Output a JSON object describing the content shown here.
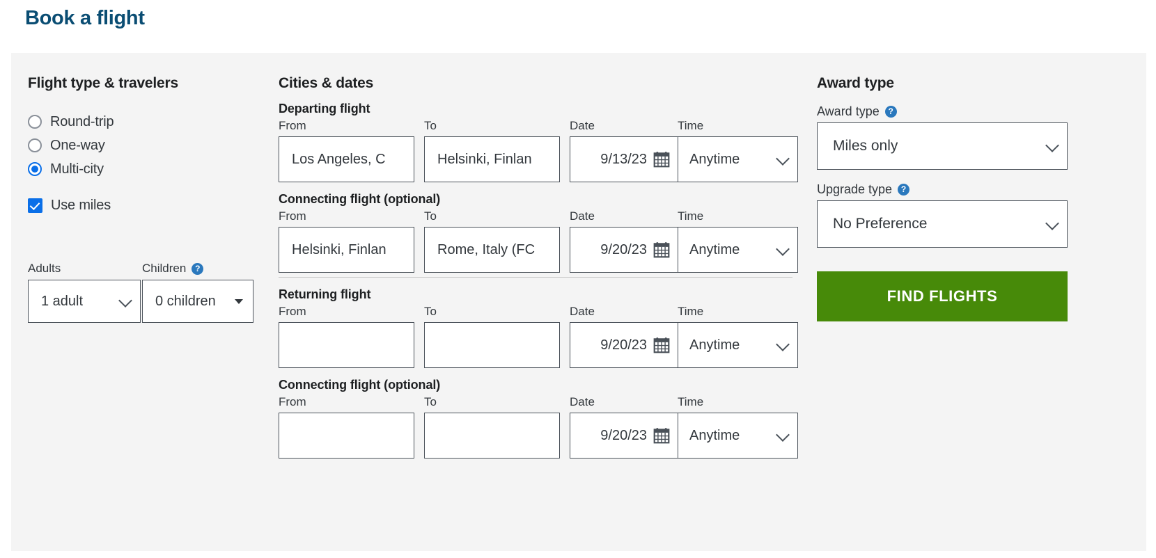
{
  "page": {
    "title": "Book a flight"
  },
  "flight_type": {
    "heading": "Flight type & travelers",
    "options": [
      {
        "label": "Round-trip",
        "selected": false
      },
      {
        "label": "One-way",
        "selected": false
      },
      {
        "label": "Multi-city",
        "selected": true
      }
    ],
    "use_miles": {
      "label": "Use miles",
      "checked": true
    },
    "adults": {
      "label": "Adults",
      "value": "1 adult"
    },
    "children": {
      "label": "Children",
      "value": "0 children",
      "help": "?"
    }
  },
  "cities": {
    "heading": "Cities & dates",
    "labels": {
      "from": "From",
      "to": "To",
      "date": "Date",
      "time": "Time"
    },
    "legs": [
      {
        "title": "Departing flight",
        "from": "Los Angeles, C",
        "to": "Helsinki, Finlan",
        "date": "9/13/23",
        "time": "Anytime",
        "divider_after": false
      },
      {
        "title": "Connecting flight (optional)",
        "from": "Helsinki, Finlan",
        "to": "Rome, Italy (FC",
        "date": "9/20/23",
        "time": "Anytime",
        "divider_after": true
      },
      {
        "title": "Returning flight",
        "from": "",
        "to": "",
        "date": "9/20/23",
        "time": "Anytime",
        "divider_after": false
      },
      {
        "title": "Connecting flight (optional)",
        "from": "",
        "to": "",
        "date": "9/20/23",
        "time": "Anytime",
        "divider_after": false
      }
    ]
  },
  "award": {
    "heading": "Award type",
    "award_type": {
      "label": "Award type",
      "value": "Miles only",
      "help": "?"
    },
    "upgrade_type": {
      "label": "Upgrade type",
      "value": "No Preference",
      "help": "?"
    },
    "submit_label": "FIND FLIGHTS"
  },
  "colors": {
    "title_blue": "#0a4d73",
    "accent_blue": "#0a6fe8",
    "help_blue": "#2a78bd",
    "submit_green": "#478a09",
    "panel_gray": "#f4f4f4",
    "border_gray": "#4a5159"
  }
}
